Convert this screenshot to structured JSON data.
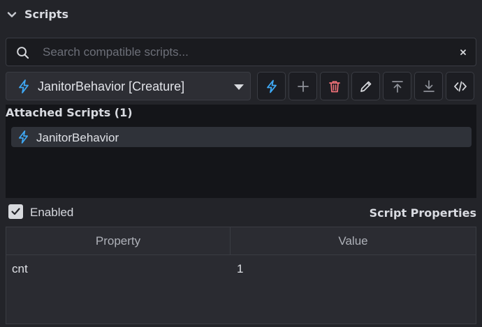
{
  "section": {
    "title": "Scripts",
    "icon": "chevron-down-icon"
  },
  "search": {
    "placeholder": "Search compatible scripts...",
    "value": ""
  },
  "script_dropdown": {
    "selected": "JanitorBehavior [Creature]",
    "icon": "bolt-icon"
  },
  "toolbar": [
    {
      "name": "script-bolt-button",
      "icon": "bolt-icon"
    },
    {
      "name": "add-script-button",
      "icon": "plus-icon"
    },
    {
      "name": "delete-script-button",
      "icon": "trash-icon"
    },
    {
      "name": "edit-script-button",
      "icon": "pencil-icon"
    },
    {
      "name": "move-to-top-button",
      "icon": "arrow-up-to-top-icon"
    },
    {
      "name": "move-to-bottom-button",
      "icon": "arrow-down-to-bottom-icon"
    },
    {
      "name": "view-code-button",
      "icon": "code-icon"
    }
  ],
  "attached": {
    "title": "Attached Scripts (1)",
    "items": [
      {
        "label": "JanitorBehavior",
        "icon": "bolt-icon"
      }
    ]
  },
  "enabled": {
    "label": "Enabled",
    "checked": true
  },
  "properties": {
    "title": "Script Properties",
    "columns": [
      "Property",
      "Value"
    ],
    "rows": [
      {
        "property": "cnt",
        "value": "1"
      }
    ]
  },
  "colors": {
    "accent": "#3fa9f5",
    "danger": "#f07178",
    "background": "#232429",
    "panel": "#141519"
  }
}
